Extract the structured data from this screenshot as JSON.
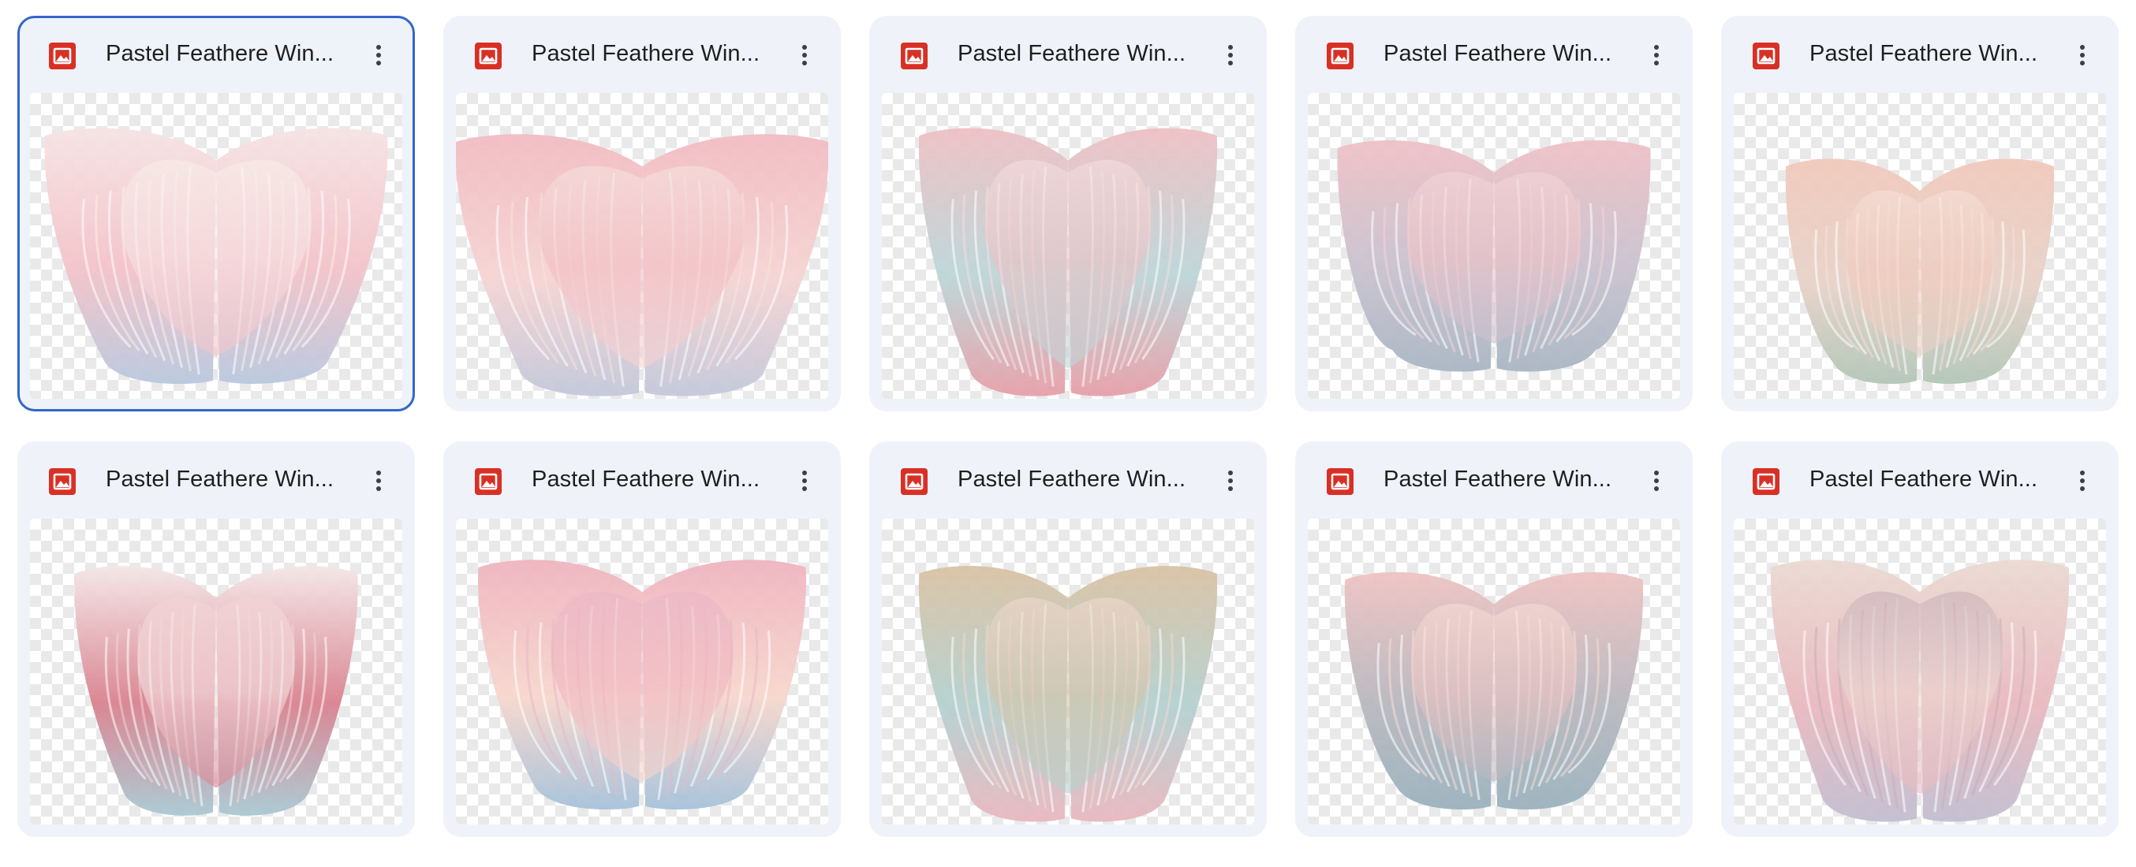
{
  "files": [
    {
      "title": "Pastel Feathere Win...",
      "selected": true,
      "palette": [
        "#f6e3e3",
        "#f3c3c9",
        "#b9c8de",
        "#f8eee8"
      ]
    },
    {
      "title": "Pastel Feathere Win...",
      "selected": false,
      "palette": [
        "#f1bcc2",
        "#f6d4d3",
        "#c3c8da",
        "#f5e2df"
      ]
    },
    {
      "title": "Pastel Feathere Win...",
      "selected": false,
      "palette": [
        "#eec0c4",
        "#bcd6d8",
        "#e79fa8",
        "#f5dede"
      ]
    },
    {
      "title": "Pastel Feathere Win...",
      "selected": false,
      "palette": [
        "#efc1c6",
        "#c9c2cf",
        "#a9b6c3",
        "#f2d6d8"
      ]
    },
    {
      "title": "Pastel Feathere Win...",
      "selected": false,
      "palette": [
        "#f0c9bb",
        "#e8d2c8",
        "#b2c6b8",
        "#f4e0da"
      ]
    },
    {
      "title": "Pastel Feathere Win...",
      "selected": false,
      "palette": [
        "#f4e6e6",
        "#d9828f",
        "#a9c9d3",
        "#f3d4d4"
      ]
    },
    {
      "title": "Pastel Feathere Win...",
      "selected": false,
      "palette": [
        "#efb4bf",
        "#f7d7cd",
        "#a6c2da",
        "#e9b8c6"
      ]
    },
    {
      "title": "Pastel Feathere Win...",
      "selected": false,
      "palette": [
        "#d9c2a4",
        "#b4d1d0",
        "#e9b7bf",
        "#f0d9cf"
      ]
    },
    {
      "title": "Pastel Feathere Win...",
      "selected": false,
      "palette": [
        "#eec3c2",
        "#b9b8bf",
        "#9ab2bd",
        "#f5dcd5"
      ]
    },
    {
      "title": "Pastel Feathere Win...",
      "selected": false,
      "palette": [
        "#eadad2",
        "#e9b9bf",
        "#c2bed0",
        "#c7aeb8"
      ]
    }
  ],
  "icons": {
    "file_type": "image-file-icon",
    "more": "more-vert-icon"
  },
  "colors": {
    "card_bg": "#eff3f9",
    "selected_border": "#3366cc",
    "file_icon": "#d93025",
    "title_text": "#1f1f1f"
  }
}
